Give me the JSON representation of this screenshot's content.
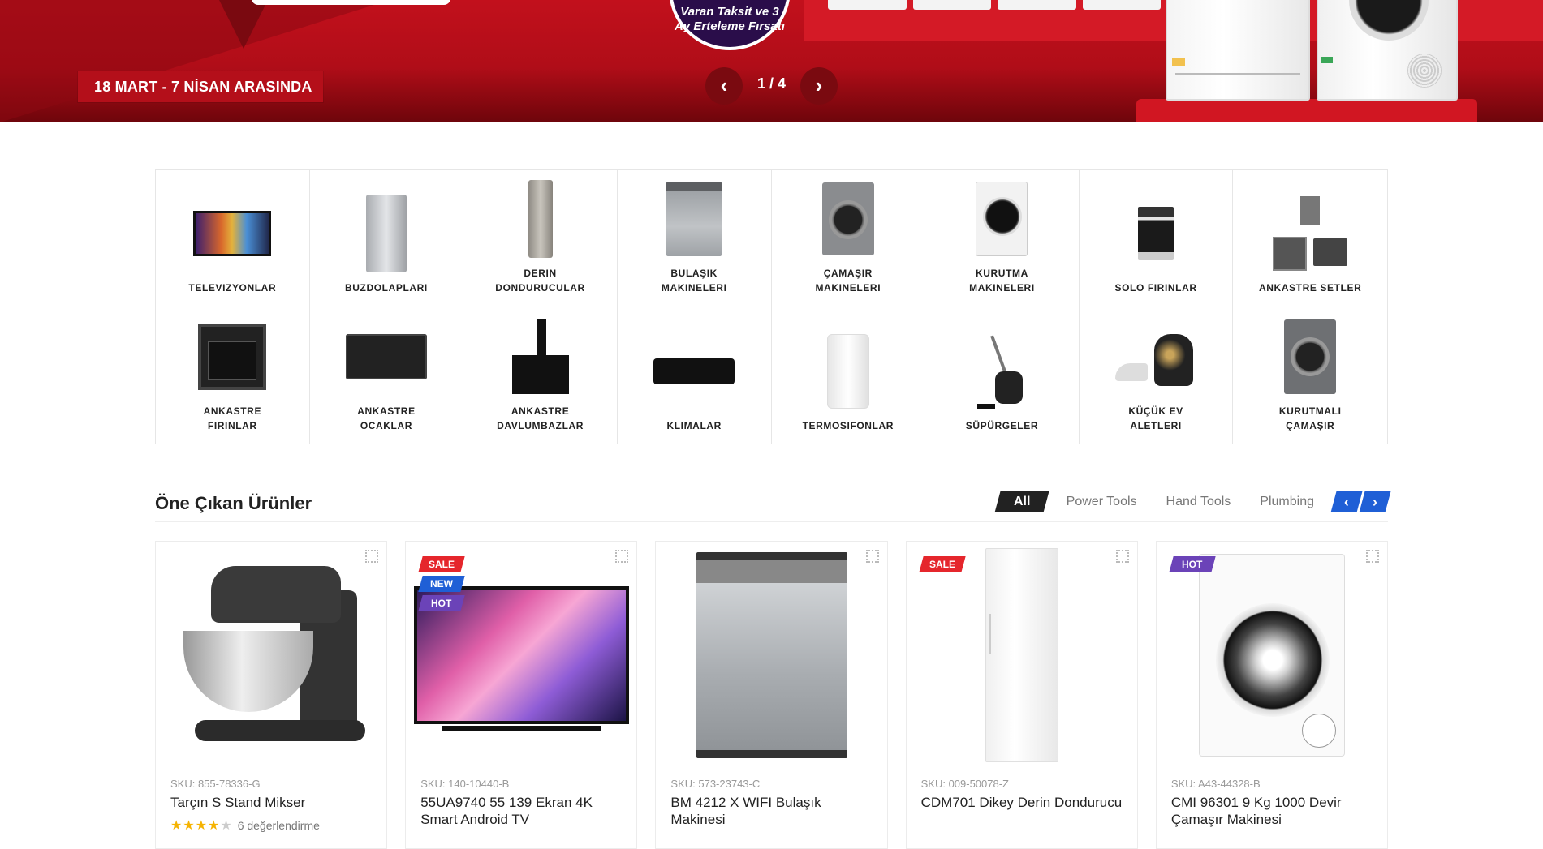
{
  "hero": {
    "date_text": "18 MART - 7 NİSAN ARASINDA",
    "badge_text": "Varan Taksit ve 3 Ay Erteleme Fırsatı",
    "prev_icon": "‹",
    "next_icon": "›",
    "counter": "1 / 4"
  },
  "categories": [
    {
      "label": "TELEVIZYONLAR",
      "icon": "tv-icon"
    },
    {
      "label": "BUZDOLAPLARI",
      "icon": "fridge-icon"
    },
    {
      "label": "DERIN DONDURUCULAR",
      "icon": "freezer-icon"
    },
    {
      "label": "BULAŞIK MAKINELERI",
      "icon": "dishwasher-icon"
    },
    {
      "label": "ÇAMAŞIR MAKINELERI",
      "icon": "washing-machine-icon"
    },
    {
      "label": "KURUTMA MAKINELERI",
      "icon": "dryer-icon"
    },
    {
      "label": "SOLO FIRINLAR",
      "icon": "oven-icon"
    },
    {
      "label": "ANKASTRE SETLER",
      "icon": "built-in-set-icon"
    },
    {
      "label": "ANKASTRE FIRINLAR",
      "icon": "built-in-oven-icon"
    },
    {
      "label": "ANKASTRE OCAKLAR",
      "icon": "hob-icon"
    },
    {
      "label": "ANKASTRE DAVLUMBAZLAR",
      "icon": "hood-icon"
    },
    {
      "label": "KLIMALAR",
      "icon": "air-conditioner-icon"
    },
    {
      "label": "TERMOSIFONLAR",
      "icon": "water-heater-icon"
    },
    {
      "label": "SÜPÜRGELER",
      "icon": "vacuum-icon"
    },
    {
      "label": "KÜÇÜK EV ALETLERI",
      "icon": "small-appliance-icon"
    },
    {
      "label": "KURUTMALI ÇAMAŞIR",
      "icon": "washer-dryer-icon"
    }
  ],
  "featured": {
    "title": "Öne Çıkan Ürünler",
    "tabs": [
      "All",
      "Power Tools",
      "Hand Tools",
      "Plumbing"
    ],
    "prev_icon": "‹",
    "next_icon": "›"
  },
  "products": [
    {
      "sku": "SKU: 855-78336-G",
      "name": "Tarçın S Stand Mikser",
      "badges": [],
      "rating": 4,
      "rating_text": "6 değerlendirme",
      "stars_on": "★★★★",
      "stars_off": "★"
    },
    {
      "sku": "SKU: 140-10440-B",
      "name": "55UA9740 55 139 Ekran 4K Smart Android TV",
      "badges": [
        "SALE",
        "NEW",
        "HOT"
      ]
    },
    {
      "sku": "SKU: 573-23743-C",
      "name": "BM 4212 X WIFI Bulaşık Makinesi",
      "badges": []
    },
    {
      "sku": "SKU: 009-50078-Z",
      "name": "CDM701 Dikey Derin Dondurucu",
      "badges": [
        "SALE"
      ]
    },
    {
      "sku": "SKU: A43-44328-B",
      "name": "CMI 96301 9 Kg 1000 Devir Çamaşır Makinesi",
      "badges": [
        "HOT"
      ]
    }
  ],
  "colors": {
    "hero_red": "#c2101c",
    "badge_sale": "#e5262c",
    "badge_new": "#1f5fd6",
    "badge_hot": "#6b43b8",
    "tab_active": "#222222",
    "star": "#f5b301"
  }
}
